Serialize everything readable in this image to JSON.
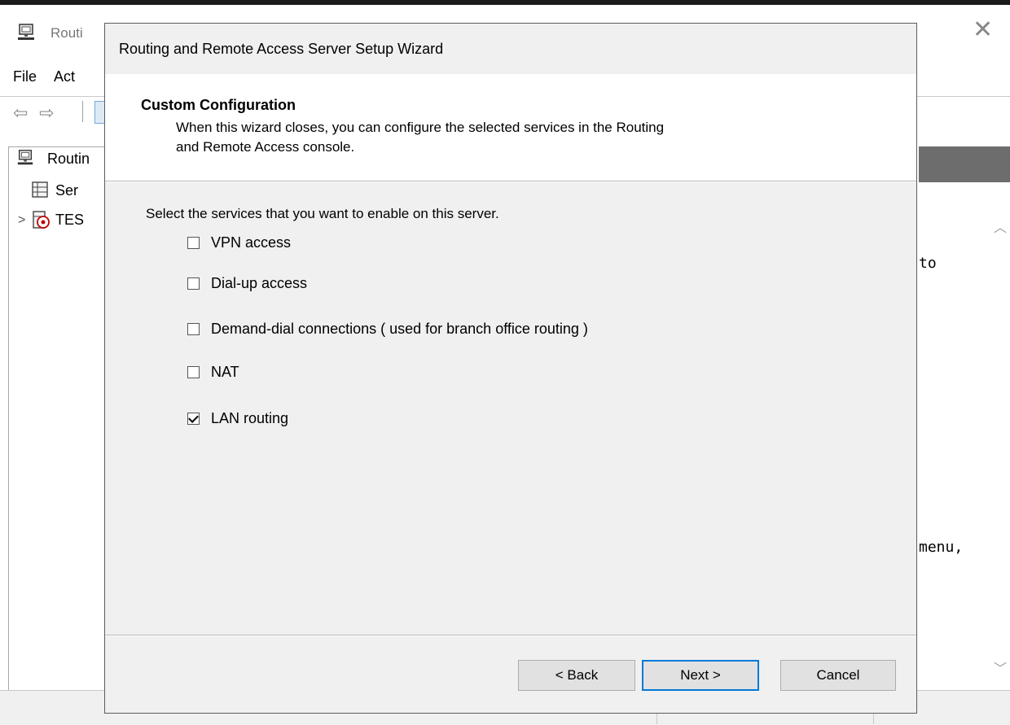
{
  "background_window": {
    "title": "Routi",
    "close_glyph": "✕",
    "menu": [
      "File",
      "Act"
    ],
    "toolbar": {
      "back_glyph": "⇦",
      "forward_glyph": "⇨"
    },
    "tree": {
      "root": "Routin",
      "server_status": "Ser",
      "host": "TES",
      "expander_glyph": ">"
    },
    "right_pane": {
      "fragment_1": "to",
      "fragment_2": "menu,",
      "scroll_up_glyph": "︿",
      "scroll_down_glyph": "﹀"
    }
  },
  "wizard": {
    "title": "Routing and Remote Access Server Setup Wizard",
    "heading": "Custom Configuration",
    "description_line1": "When this wizard closes, you can configure the selected services in the Routing",
    "description_line2": "and Remote Access console.",
    "prompt": "Select the services that you want to enable on this server.",
    "options": [
      {
        "label": "VPN access",
        "checked": false
      },
      {
        "label": "Dial-up access",
        "checked": false
      },
      {
        "label": "Demand-dial connections ( used for branch office routing )",
        "checked": false
      },
      {
        "label": "NAT",
        "checked": false
      },
      {
        "label": "LAN routing",
        "checked": true
      }
    ],
    "buttons": {
      "back": "< Back",
      "next": "Next >",
      "cancel": "Cancel"
    },
    "default_button_color": "#0078d7"
  }
}
